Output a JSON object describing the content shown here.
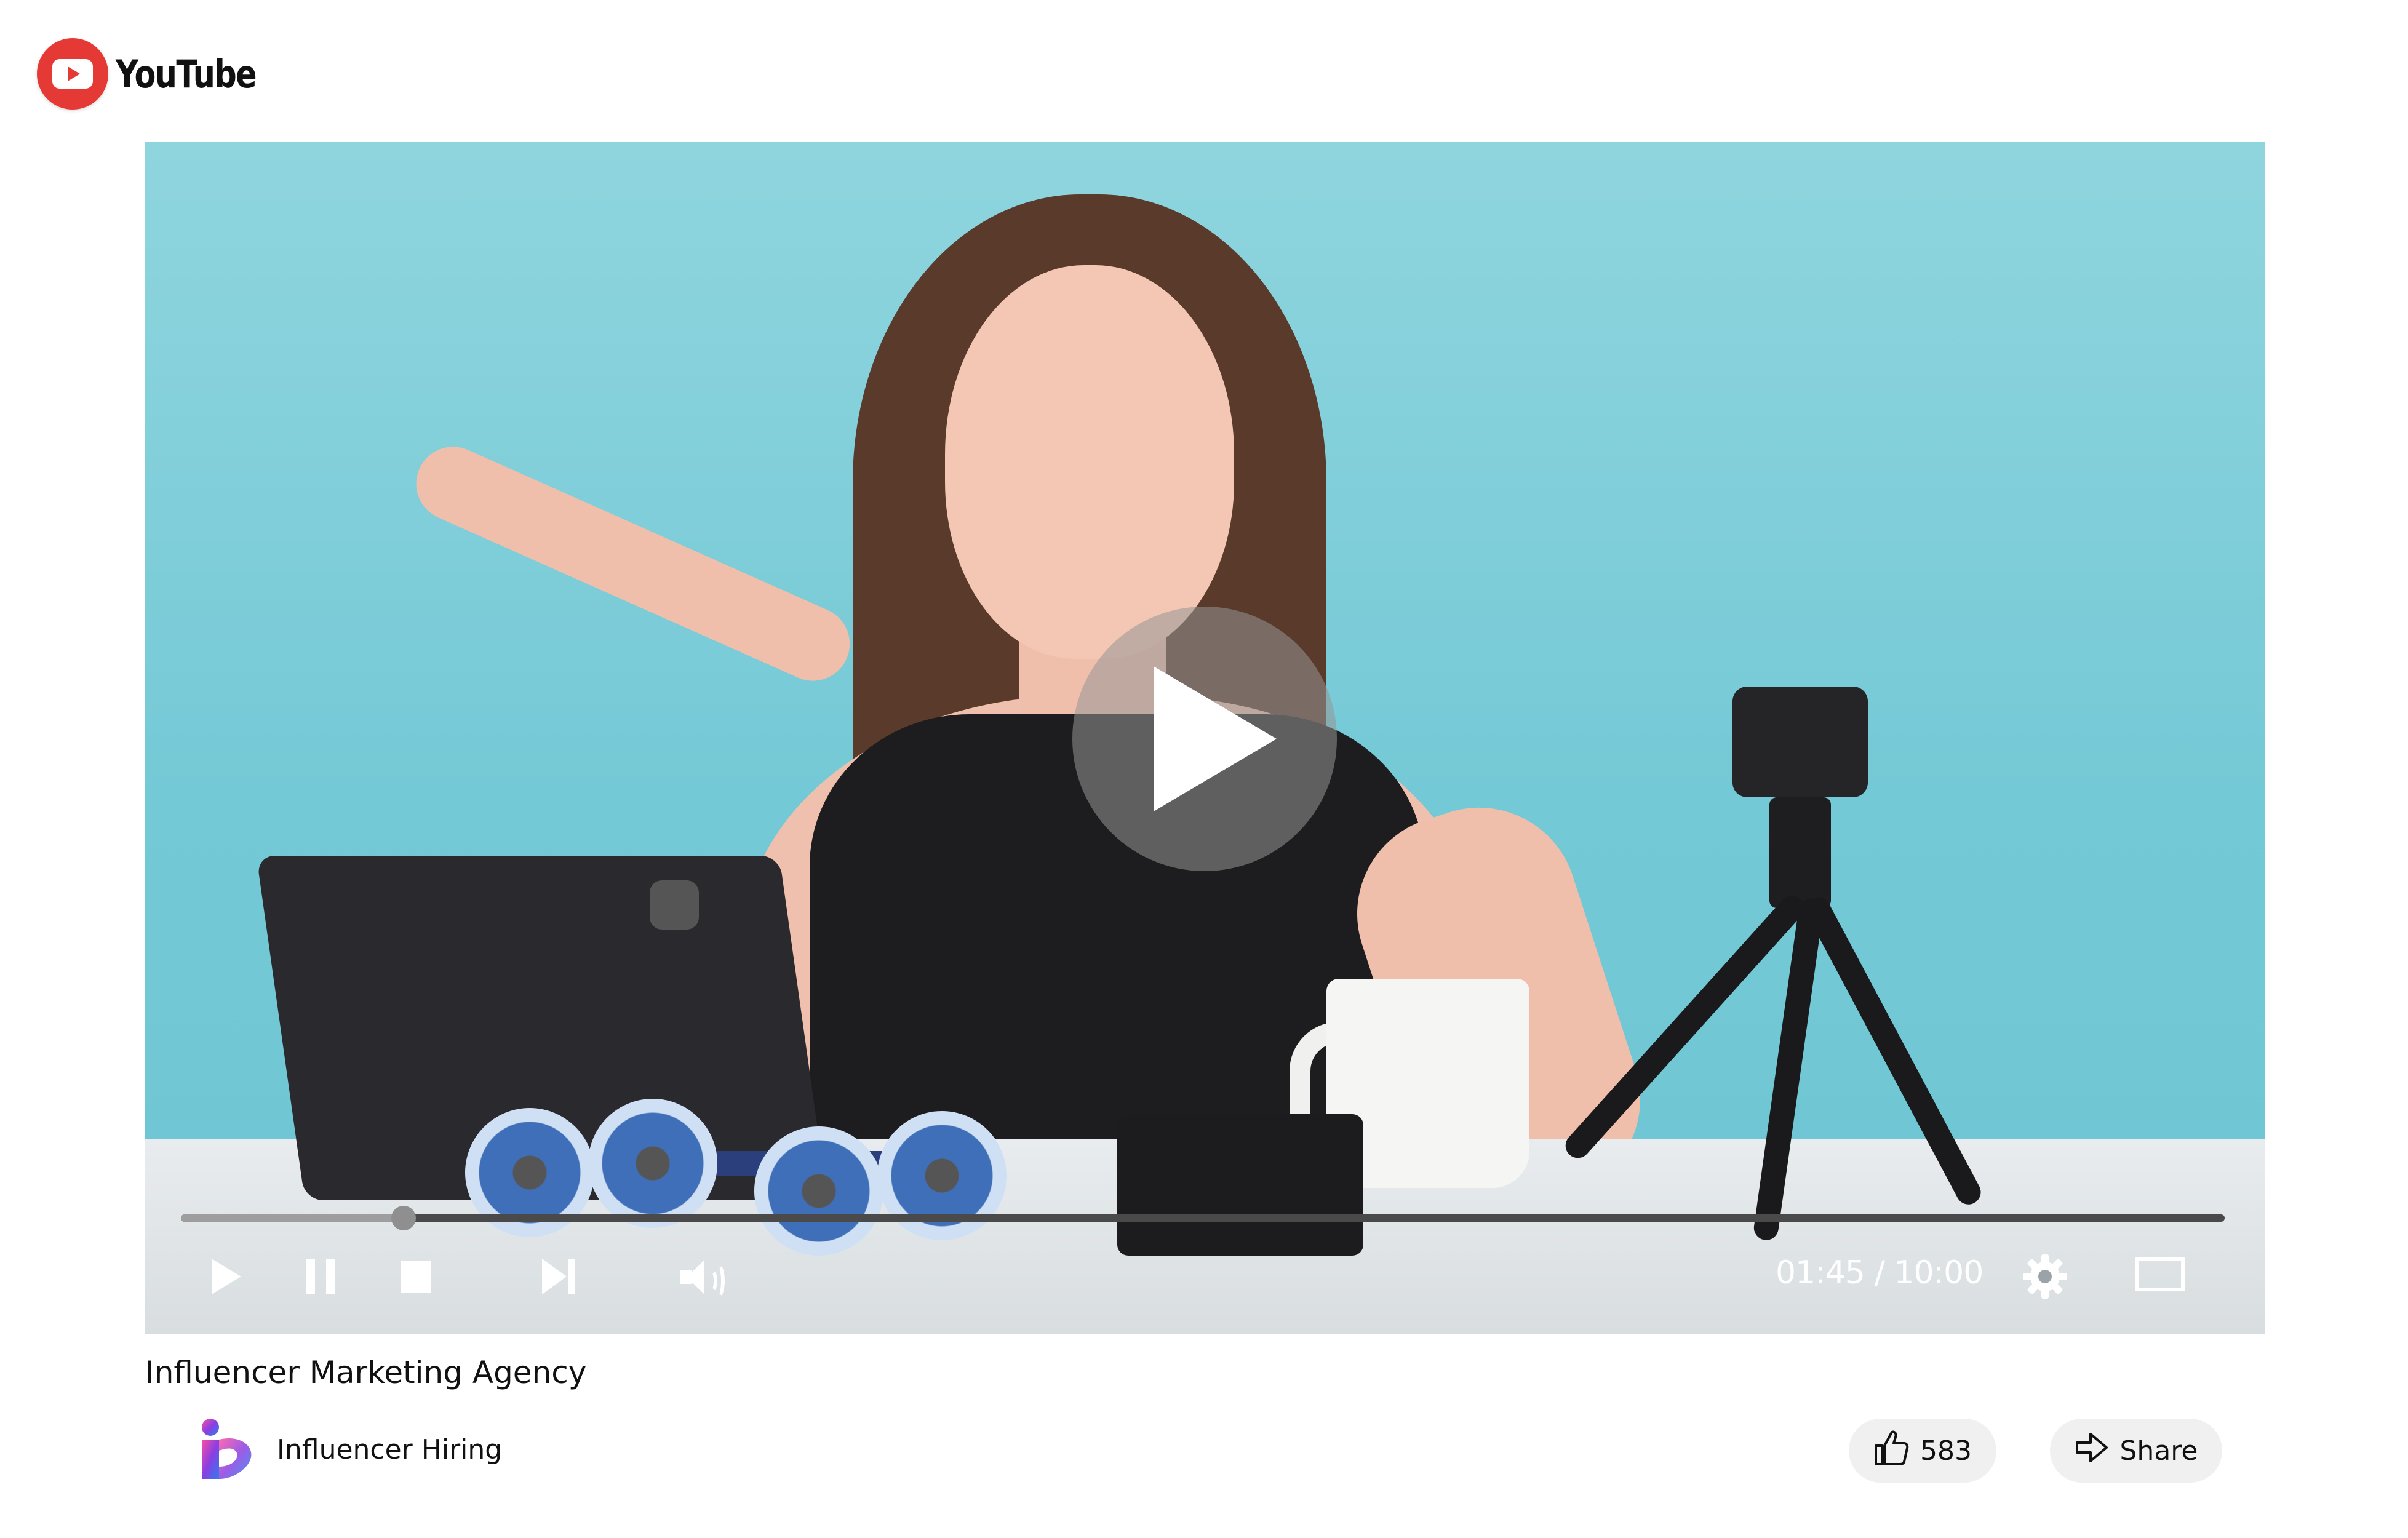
{
  "header": {
    "brand": "YouTube",
    "brand_icon": "youtube-play-icon",
    "brand_color": "#e53935"
  },
  "player": {
    "center_icon": "play-icon",
    "progress_fraction": 0.109,
    "time_display": "01:45 / 10:00",
    "controls": {
      "play_icon": "play-icon",
      "pause_icon": "pause-icon",
      "stop_icon": "stop-icon",
      "next_icon": "skip-next-icon",
      "volume_icon": "volume-icon",
      "settings_icon": "gear-icon",
      "fullscreen_icon": "fullscreen-icon"
    }
  },
  "video": {
    "title": "Influencer Marketing Agency"
  },
  "channel": {
    "name": "Influencer Hiring",
    "logo_icon": "influencer-hiring-logo"
  },
  "actions": {
    "like_count": "583",
    "like_icon": "thumbs-up-icon",
    "share_label": "Share",
    "share_icon": "share-arrow-icon"
  }
}
